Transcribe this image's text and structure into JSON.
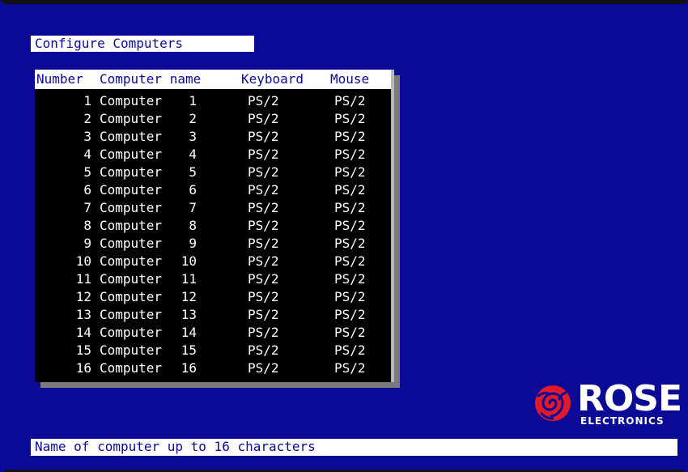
{
  "header": {
    "title": "Configure Computers"
  },
  "table": {
    "columns": [
      "Number",
      "Computer name",
      "Keyboard",
      "Mouse"
    ],
    "rows": [
      {
        "number": "1",
        "name": "Computer",
        "name_num": "1",
        "keyboard": "PS/2",
        "mouse": "PS/2"
      },
      {
        "number": "2",
        "name": "Computer",
        "name_num": "2",
        "keyboard": "PS/2",
        "mouse": "PS/2"
      },
      {
        "number": "3",
        "name": "Computer",
        "name_num": "3",
        "keyboard": "PS/2",
        "mouse": "PS/2"
      },
      {
        "number": "4",
        "name": "Computer",
        "name_num": "4",
        "keyboard": "PS/2",
        "mouse": "PS/2"
      },
      {
        "number": "5",
        "name": "Computer",
        "name_num": "5",
        "keyboard": "PS/2",
        "mouse": "PS/2"
      },
      {
        "number": "6",
        "name": "Computer",
        "name_num": "6",
        "keyboard": "PS/2",
        "mouse": "PS/2"
      },
      {
        "number": "7",
        "name": "Computer",
        "name_num": "7",
        "keyboard": "PS/2",
        "mouse": "PS/2"
      },
      {
        "number": "8",
        "name": "Computer",
        "name_num": "8",
        "keyboard": "PS/2",
        "mouse": "PS/2"
      },
      {
        "number": "9",
        "name": "Computer",
        "name_num": "9",
        "keyboard": "PS/2",
        "mouse": "PS/2"
      },
      {
        "number": "10",
        "name": "Computer",
        "name_num": "10",
        "keyboard": "PS/2",
        "mouse": "PS/2"
      },
      {
        "number": "11",
        "name": "Computer",
        "name_num": "11",
        "keyboard": "PS/2",
        "mouse": "PS/2"
      },
      {
        "number": "12",
        "name": "Computer",
        "name_num": "12",
        "keyboard": "PS/2",
        "mouse": "PS/2"
      },
      {
        "number": "13",
        "name": "Computer",
        "name_num": "13",
        "keyboard": "PS/2",
        "mouse": "PS/2"
      },
      {
        "number": "14",
        "name": "Computer",
        "name_num": "14",
        "keyboard": "PS/2",
        "mouse": "PS/2"
      },
      {
        "number": "15",
        "name": "Computer",
        "name_num": "15",
        "keyboard": "PS/2",
        "mouse": "PS/2"
      },
      {
        "number": "16",
        "name": "Computer",
        "name_num": "16",
        "keyboard": "PS/2",
        "mouse": "PS/2"
      }
    ]
  },
  "status": {
    "text": "Name of computer up to 16 characters"
  },
  "logo": {
    "word": "ROSE",
    "subtitle": "ELECTRONICS",
    "icon": "rose-icon"
  },
  "colors": {
    "background": "#0a0a96",
    "bar": "#ffffff",
    "table": "#000000",
    "logo_red": "#e01a2b"
  }
}
